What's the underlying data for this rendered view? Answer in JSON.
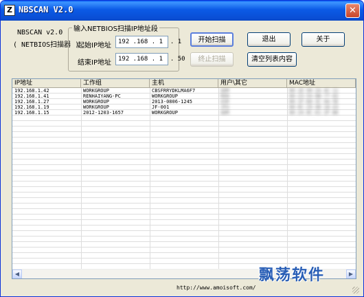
{
  "window": {
    "title": "NBSCAN V2.0",
    "icon": "app-icon",
    "icon_glyph": "Z"
  },
  "info": {
    "name": "NBSCAN v2.0",
    "subtitle": "( NETBIOS扫描器 )"
  },
  "range": {
    "group_title": "输入NETBIOS扫描IP地址段",
    "start_label": "起始IP地址",
    "start_ip": "192 .168 . 1  . 1",
    "end_label": "结束IP地址",
    "end_ip": "192 .168 . 1  . 50"
  },
  "buttons": {
    "start": "开始扫描",
    "stop": "终止扫描",
    "exit": "退出",
    "about": "关于",
    "clear": "清空列表内容"
  },
  "table": {
    "columns": [
      "IP地址",
      "工作组",
      "主机",
      "用户\\其它",
      "MAC地址"
    ],
    "rows": [
      [
        "192.168.1.42",
        "WORKGROUP",
        "CBSFRRYDKLMA6F7",
        "ADM",
        "00-1E-90-2A-4C-11"
      ],
      [
        "192.168.1.41",
        "RENHAIYANG-PC",
        "WORKGROUP",
        "REN",
        "00-23-54-8B-77-02"
      ],
      [
        "192.168.1.27",
        "WORKGROUP",
        "2013-0806-1245",
        "USR",
        "00-1F-D0-3C-9A-5E"
      ],
      [
        "192.168.1.19",
        "WORKGROUP",
        "JF-001",
        "JFU",
        "00-0C-29-4D-18-A3"
      ],
      [
        "192.168.1.15",
        "2012-1203-1657",
        "WORKGROUP",
        "ADM",
        "00-24-8C-61-2F-B0"
      ]
    ]
  },
  "footer": {
    "url": "http://www.amoisoft.com/"
  },
  "watermark": "飘荡软件"
}
